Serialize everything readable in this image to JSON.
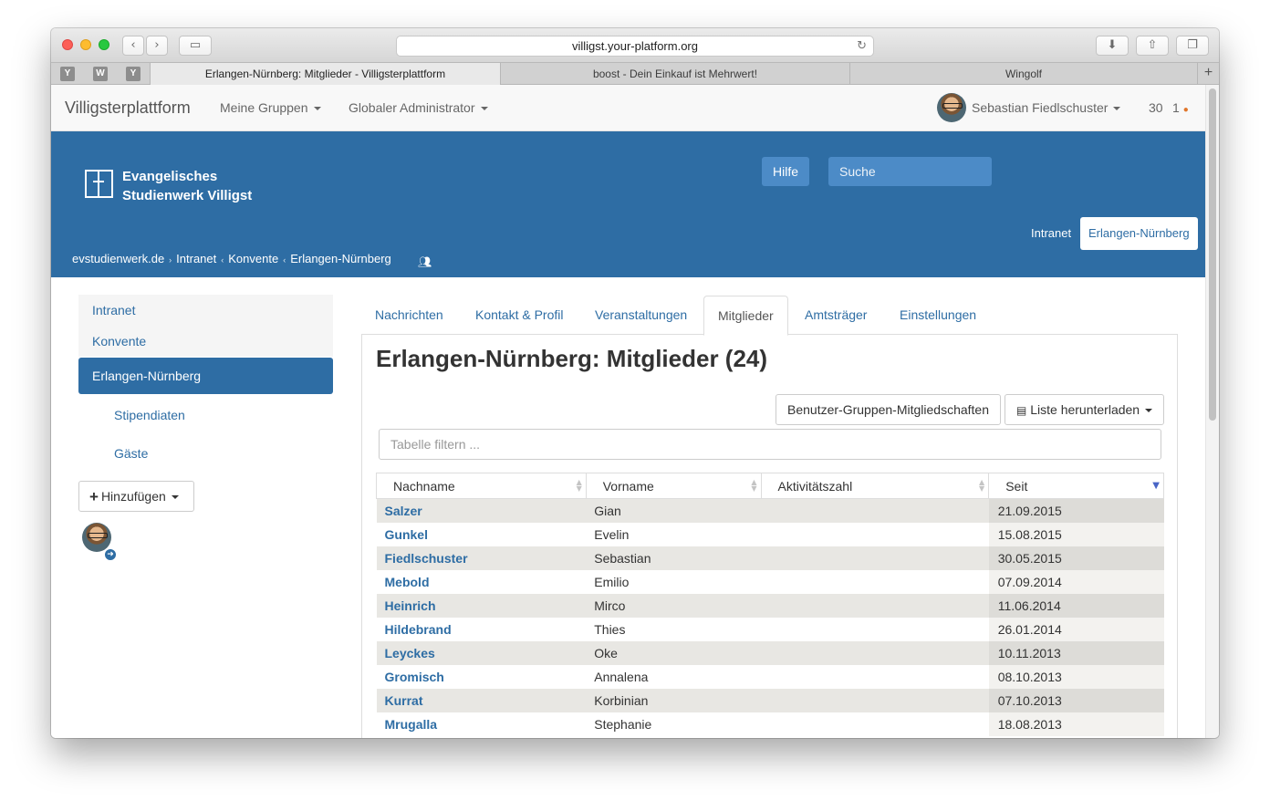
{
  "browser": {
    "url": "villigst.your-platform.org",
    "pinned_tabs": [
      "Y",
      "W",
      "Y"
    ],
    "tabs": [
      {
        "title": "Erlangen-Nürnberg: Mitglieder - Villigsterplattform",
        "active": true
      },
      {
        "title": "boost - Dein Einkauf ist Mehrwert!",
        "active": false
      },
      {
        "title": "Wingolf",
        "active": false
      }
    ]
  },
  "navbar": {
    "brand": "Villigsterplattform",
    "menu_groups": "Meine Gruppen",
    "menu_admin": "Globaler Administrator",
    "user_name": "Sebastian Fiedlschuster",
    "count_a": "30",
    "count_b": "1"
  },
  "header": {
    "logo_line1": "Evangelisches",
    "logo_line2": "Studienwerk Villigst",
    "help_label": "Hilfe",
    "search_placeholder": "Suche",
    "breadcrumbs": [
      "evstudienwerk.de",
      "Intranet",
      "Konvente",
      "Erlangen-Nürnberg"
    ],
    "tab_intranet": "Intranet",
    "tab_active": "Erlangen-Nürnberg"
  },
  "sidebar": {
    "items": [
      "Intranet",
      "Konvente",
      "Erlangen-Nürnberg"
    ],
    "subitems": [
      "Stipendiaten",
      "Gäste"
    ],
    "add_label": "Hinzufügen"
  },
  "content": {
    "tabs": [
      "Nachrichten",
      "Kontakt & Profil",
      "Veranstaltungen",
      "Mitglieder",
      "Amtsträger",
      "Einstellungen"
    ],
    "title": "Erlangen-Nürnberg: Mitglieder (24)",
    "btn_memberships": "Benutzer-Gruppen-Mitgliedschaften",
    "btn_download": "Liste herunterladen",
    "filter_placeholder": "Tabelle filtern ...",
    "columns": [
      "Nachname",
      "Vorname",
      "Aktivitätszahl",
      "Seit"
    ],
    "rows": [
      {
        "last": "Salzer",
        "first": "Gian",
        "activity": "",
        "since": "21.09.2015"
      },
      {
        "last": "Gunkel",
        "first": "Evelin",
        "activity": "",
        "since": "15.08.2015"
      },
      {
        "last": "Fiedlschuster",
        "first": "Sebastian",
        "activity": "",
        "since": "30.05.2015"
      },
      {
        "last": "Mebold",
        "first": "Emilio",
        "activity": "",
        "since": "07.09.2014"
      },
      {
        "last": "Heinrich",
        "first": "Mirco",
        "activity": "",
        "since": "11.06.2014"
      },
      {
        "last": "Hildebrand",
        "first": "Thies",
        "activity": "",
        "since": "26.01.2014"
      },
      {
        "last": "Leyckes",
        "first": "Oke",
        "activity": "",
        "since": "10.11.2013"
      },
      {
        "last": "Gromisch",
        "first": "Annalena",
        "activity": "",
        "since": "08.10.2013"
      },
      {
        "last": "Kurrat",
        "first": "Korbinian",
        "activity": "",
        "since": "07.10.2013"
      },
      {
        "last": "Mrugalla",
        "first": "Stephanie",
        "activity": "",
        "since": "18.08.2013"
      }
    ]
  }
}
